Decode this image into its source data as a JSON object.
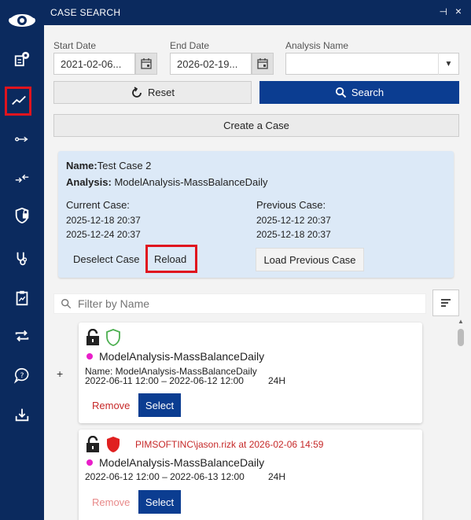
{
  "colors": {
    "sidebar_bg": "#0b2a5e",
    "primary": "#0b3d91",
    "highlight_red": "#e0141e",
    "panel_bg": "#dce9f7",
    "status_magenta": "#e91ec9",
    "shield_green": "#4caf50",
    "shield_red": "#e02020"
  },
  "sidebar": {
    "logo": "eye-logo",
    "items": [
      {
        "icon": "reports-gear-icon"
      },
      {
        "icon": "trend-chart-icon",
        "active": true
      },
      {
        "icon": "arrow-right-icon"
      },
      {
        "icon": "arrows-merge-icon"
      },
      {
        "icon": "shield-lock-icon"
      },
      {
        "icon": "stethoscope-icon"
      },
      {
        "icon": "clipboard-chart-icon"
      },
      {
        "icon": "repeat-icon"
      },
      {
        "icon": "help-chat-icon"
      },
      {
        "icon": "download-icon"
      }
    ]
  },
  "header": {
    "title": "CASE SEARCH",
    "pin_icon": "pin-icon",
    "close_icon": "close-icon"
  },
  "search": {
    "start_label": "Start Date",
    "start_value": "2021-02-06...",
    "end_label": "End Date",
    "end_value": "2026-02-19...",
    "analysis_label": "Analysis Name",
    "analysis_value": "",
    "reset_label": "Reset",
    "search_label": "Search",
    "create_label": "Create a Case"
  },
  "case": {
    "name_label": "Name:",
    "name_value": "Test Case 2",
    "analysis_label": "Analysis:",
    "analysis_value": "ModelAnalysis-MassBalanceDaily",
    "current_label": "Current Case:",
    "current_start": "2025-12-18 20:37",
    "current_end": "2025-12-24 20:37",
    "previous_label": "Previous Case:",
    "previous_start": "2025-12-12 20:37",
    "previous_end": "2025-12-18 20:37",
    "deselect_label": "Deselect Case",
    "reload_label": "Reload",
    "load_prev_label": "Load Previous Case"
  },
  "filter": {
    "placeholder": "Filter by Name"
  },
  "list": {
    "expand_label": "+",
    "items": [
      {
        "lock": "unlocked",
        "shield": "green",
        "locked_by": "",
        "name": "ModelAnalysis-MassBalanceDaily",
        "detail_name": "Name: ModelAnalysis-MassBalanceDaily",
        "range": "2022-06-11 12:00 – 2022-06-12 12:00",
        "interval": "24H",
        "remove_label": "Remove",
        "select_label": "Select"
      },
      {
        "lock": "unlocked",
        "shield": "red",
        "locked_by": "PIMSOFTINC\\jason.rizk at 2026-02-06 14:59",
        "name": "ModelAnalysis-MassBalanceDaily",
        "detail_name": "",
        "range": "2022-06-12 12:00 – 2022-06-13 12:00",
        "interval": "24H",
        "remove_label": "Remove",
        "select_label": "Select"
      }
    ]
  }
}
